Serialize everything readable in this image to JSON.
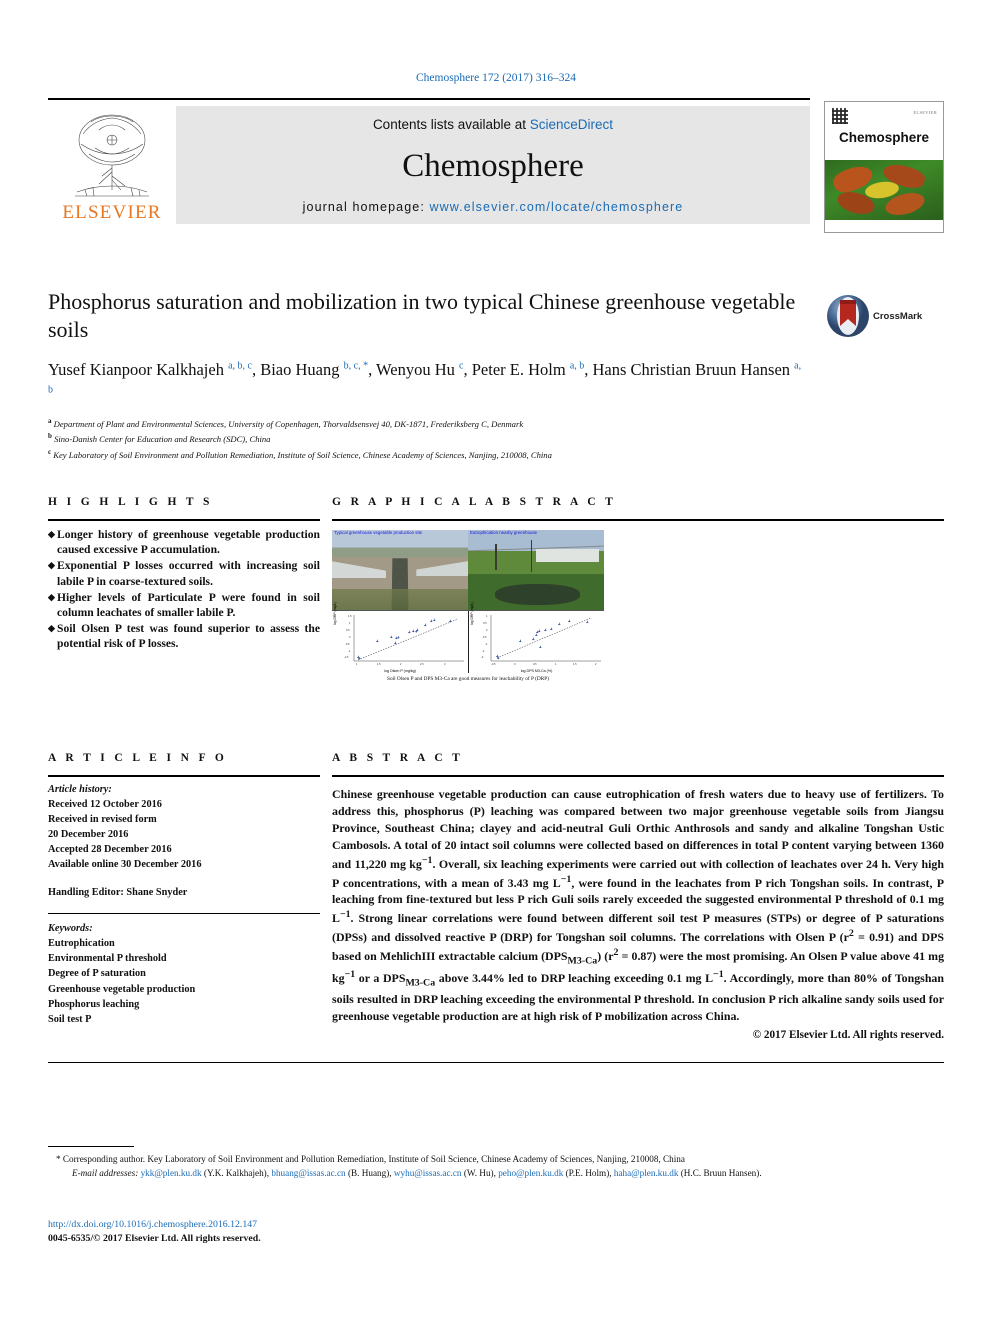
{
  "running_head": "Chemosphere 172 (2017) 316–324",
  "masthead": {
    "publisher": "ELSEVIER",
    "contents_prefix": "Contents lists available at ",
    "contents_link": "ScienceDirect",
    "journal_title": "Chemosphere",
    "homepage_prefix": "journal homepage: ",
    "homepage_url": "www.elsevier.com/locate/chemosphere",
    "cover_journal_name": "Chemosphere",
    "cover_publisher": "ELSEVIER"
  },
  "article": {
    "title": "Phosphorus saturation and mobilization in two typical Chinese greenhouse vegetable soils",
    "authors_html": "Yusef Kianpoor Kalkhajeh <sup>a, b, c</sup>, Biao Huang <sup>b, c, *</sup>, Wenyou Hu <sup>c</sup>, Peter E. Holm <sup>a, b</sup>, Hans Christian Bruun Hansen <sup>a, b</sup>",
    "affiliations": [
      {
        "marker": "a",
        "text": "Department of Plant and Environmental Sciences, University of Copenhagen, Thorvaldsensvej 40, DK-1871, Frederiksberg C, Denmark"
      },
      {
        "marker": "b",
        "text": "Sino-Danish Center for Education and Research (SDC), China"
      },
      {
        "marker": "c",
        "text": "Key Laboratory of Soil Environment and Pollution Remediation, Institute of Soil Science, Chinese Academy of Sciences, Nanjing, 210008, China"
      }
    ],
    "crossmark_label": "CrossMark"
  },
  "highlights": {
    "heading": "H I G H L I G H T S",
    "items": [
      "Longer history of greenhouse vegetable production caused excessive P accumulation.",
      "Exponential P losses occurred with increasing soil labile P in coarse-textured soils.",
      "Higher levels of Particulate P were found in soil column leachates of smaller labile P.",
      "Soil Olsen P test was found superior to assess the potential risk of P losses."
    ]
  },
  "graphical_abstract": {
    "heading": "G R A P H I C A L   A B S T R A C T",
    "photo_left_caption": "Typical greenhouse vegetable production site",
    "photo_right_caption": "Eutrophication nearby greenhouse",
    "caption": "Soil Olsen P and DPS M3-Ca are good measures for leachability of P (DRP)",
    "chart_left": {
      "ylabel": "log DRP (mg/L)",
      "xlabel": "log Olsen P (mg/kg)"
    },
    "chart_right": {
      "ylabel": "log DRP (mg/L)",
      "xlabel": "log DPS M3-Ca (%)"
    }
  },
  "chart_data": [
    {
      "type": "scatter",
      "title": "",
      "xlabel": "log Olsen P (mg/kg)",
      "ylabel": "log DRP (mg/L)",
      "xlim": [
        1.0,
        3.0
      ],
      "ylim": [
        -3.0,
        1.2
      ],
      "xticks": [
        1.0,
        1.5,
        2.0,
        2.5,
        3.0
      ],
      "yticks": [
        -3,
        -2.5,
        -2,
        -1.5,
        -1,
        -0.5,
        0,
        0.5,
        1
      ],
      "grid": false,
      "legend": "none",
      "x": [
        1.05,
        1.1,
        1.45,
        1.72,
        1.8,
        1.82,
        1.85,
        2.05,
        2.12,
        2.18,
        2.2,
        2.35,
        2.45,
        2.5,
        2.78
      ],
      "y": [
        -2.55,
        -2.7,
        -1.1,
        -0.85,
        -1.3,
        -0.95,
        -0.9,
        -0.55,
        -0.5,
        -0.52,
        -0.45,
        -0.2,
        0.05,
        0.1,
        0.05
      ],
      "trendline": {
        "r2": 0.91,
        "note": "dashed linear fit"
      }
    },
    {
      "type": "scatter",
      "title": "",
      "xlabel": "log DPS M3-Ca (%)",
      "ylabel": "log DRP (mg/L)",
      "xlim": [
        -0.5,
        2.0
      ],
      "ylim": [
        -3.0,
        1.0
      ],
      "xticks": [
        -0.5,
        0.0,
        0.5,
        1.0,
        1.5,
        2.0
      ],
      "yticks": [
        -3,
        -2.5,
        -2,
        -1.5,
        -1,
        -0.5,
        0,
        0.5,
        1
      ],
      "grid": false,
      "legend": "none",
      "x": [
        -0.3,
        -0.28,
        0.3,
        0.62,
        0.68,
        0.7,
        0.75,
        0.78,
        0.9,
        1.05,
        1.2,
        1.35,
        1.7
      ],
      "y": [
        -2.55,
        -2.72,
        -1.15,
        -1.05,
        -0.9,
        -0.6,
        -0.55,
        -1.45,
        -0.5,
        -0.45,
        -0.1,
        0.05,
        0.02
      ],
      "trendline": {
        "r2": 0.87,
        "note": "dashed linear fit"
      }
    }
  ],
  "article_info": {
    "heading": "A R T I C L E   I N F O",
    "history_label": "Article history:",
    "history": [
      "Received 12 October 2016",
      "Received in revised form",
      "20 December 2016",
      "Accepted 28 December 2016",
      "Available online 30 December 2016"
    ],
    "handling_editor": "Handling Editor: Shane Snyder",
    "keywords_label": "Keywords:",
    "keywords": [
      "Eutrophication",
      "Environmental P threshold",
      "Degree of P saturation",
      "Greenhouse vegetable production",
      "Phosphorus leaching",
      "Soil test P"
    ]
  },
  "abstract": {
    "heading": "A B S T R A C T",
    "body_html": "Chinese greenhouse vegetable production can cause eutrophication of fresh waters due to heavy use of fertilizers. To address this, phosphorus (P) leaching was compared between two major greenhouse vegetable soils from Jiangsu Province, Southeast China; clayey and acid-neutral Guli Orthic Anthrosols and sandy and alkaline Tongshan Ustic Cambosols. A total of 20 intact soil columns were collected based on differences in total P content varying between 1360 and 11,220 mg kg<sup>&#8722;1</sup>. Overall, six leaching experiments were carried out with collection of leachates over 24 h. Very high P concentrations, with a mean of 3.43 mg L<sup>&#8722;1</sup>, were found in the leachates from P rich Tongshan soils. In contrast, P leaching from fine-textured but less P rich Guli soils rarely exceeded the suggested environmental P threshold of 0.1 mg L<sup>&#8722;1</sup>. Strong linear correlations were found between different soil test P measures (STPs) or degree of P saturations (DPSs) and dissolved reactive P (DRP) for Tongshan soil columns. The correlations with Olsen P (r<sup>2</sup> = 0.91) and DPS based on MehlichIII extractable calcium (DPS<sub>M3-Ca</sub>) (r<sup>2</sup> = 0.87) were the most promising. An Olsen P value above 41 mg kg<sup>&#8722;1</sup> or a DPS<sub>M3-Ca</sub> above 3.44% led to DRP leaching exceeding 0.1 mg L<sup>&#8722;1</sup>. Accordingly, more than 80% of Tongshan soils resulted in DRP leaching exceeding the environmental P threshold. In conclusion P rich alkaline sandy soils used for greenhouse vegetable production are at high risk of P mobilization across China.",
    "copyright": "© 2017 Elsevier Ltd. All rights reserved."
  },
  "footer": {
    "corresponding_html": "* Corresponding author. Key Laboratory of Soil Environment and Pollution Remediation, Institute of Soil Science, Chinese Academy of Sciences, Nanjing, 210008, China",
    "emails_html": "<span class=\"it\">E-mail addresses:</span> <span class=\"link\">ykk@plen.ku.dk</span> (Y.K. Kalkhajeh), <span class=\"link\">bhuang@issas.ac.cn</span> (B. Huang), <span class=\"link\">wyhu@issas.ac.cn</span> (W. Hu), <span class=\"link\">peho@plen.ku.dk</span> (P.E. Holm), <span class=\"link\">haha@plen.ku.dk</span> (H.C. Bruun Hansen).",
    "doi": "http://dx.doi.org/10.1016/j.chemosphere.2016.12.147",
    "issn_copyright": "0045-6535/© 2017 Elsevier Ltd. All rights reserved."
  },
  "colors": {
    "link": "#1a6bb5",
    "elsevier_orange": "#E87722",
    "band_gray": "#e6e6e6"
  }
}
